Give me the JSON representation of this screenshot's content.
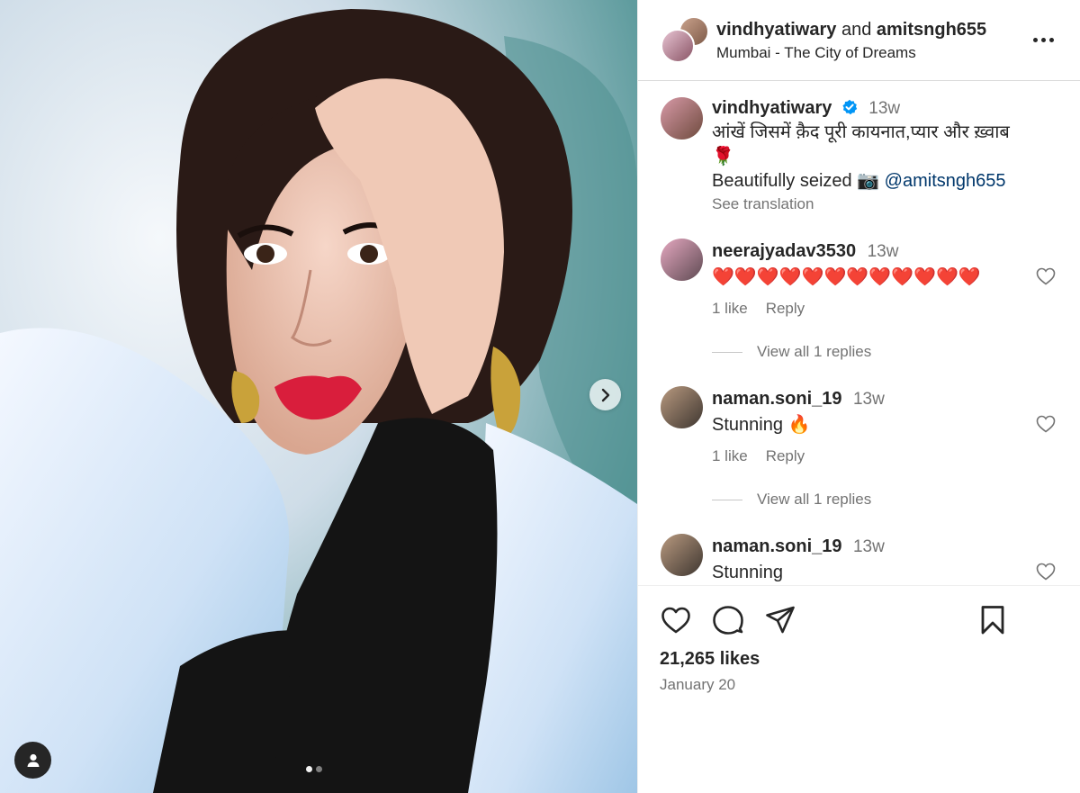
{
  "header": {
    "user1": "vindhyatiwary",
    "joiner": "and",
    "user2": "amitsngh655",
    "location": "Mumbai - The City of Dreams"
  },
  "caption": {
    "username": "vindhyatiwary",
    "time": "13w",
    "line1": "आंखें जिसमें क़ैद पूरी कायनात,प्यार और ख़्वाब",
    "emoji": "🌹",
    "line2": "Beautifully seized 📷",
    "mention": "@amitsngh655",
    "see_translation": "See translation"
  },
  "comments": [
    {
      "username": "neerajyadav3530",
      "time": "13w",
      "text": "❤️❤️❤️❤️❤️❤️❤️❤️❤️❤️❤️❤️",
      "likes": "1 like",
      "reply": "Reply",
      "view_replies": "View all 1 replies"
    },
    {
      "username": "naman.soni_19",
      "time": "13w",
      "text": "Stunning 🔥",
      "likes": "1 like",
      "reply": "Reply",
      "view_replies": "View all 1 replies"
    },
    {
      "username": "naman.soni_19",
      "time": "13w",
      "text": "Stunning"
    }
  ],
  "footer": {
    "likes": "21,265 likes",
    "date": "January 20"
  },
  "icons": {
    "like": "heart-icon",
    "comment": "comment-icon",
    "share": "share-icon",
    "save": "bookmark-icon",
    "more": "more-options-icon",
    "next": "chevron-right-icon",
    "tags": "user-tag-icon"
  },
  "carousel": {
    "current": 1,
    "total": 2
  },
  "colors": {
    "verified": "#0095f6",
    "mention": "#00376b",
    "secondary": "#737373"
  }
}
